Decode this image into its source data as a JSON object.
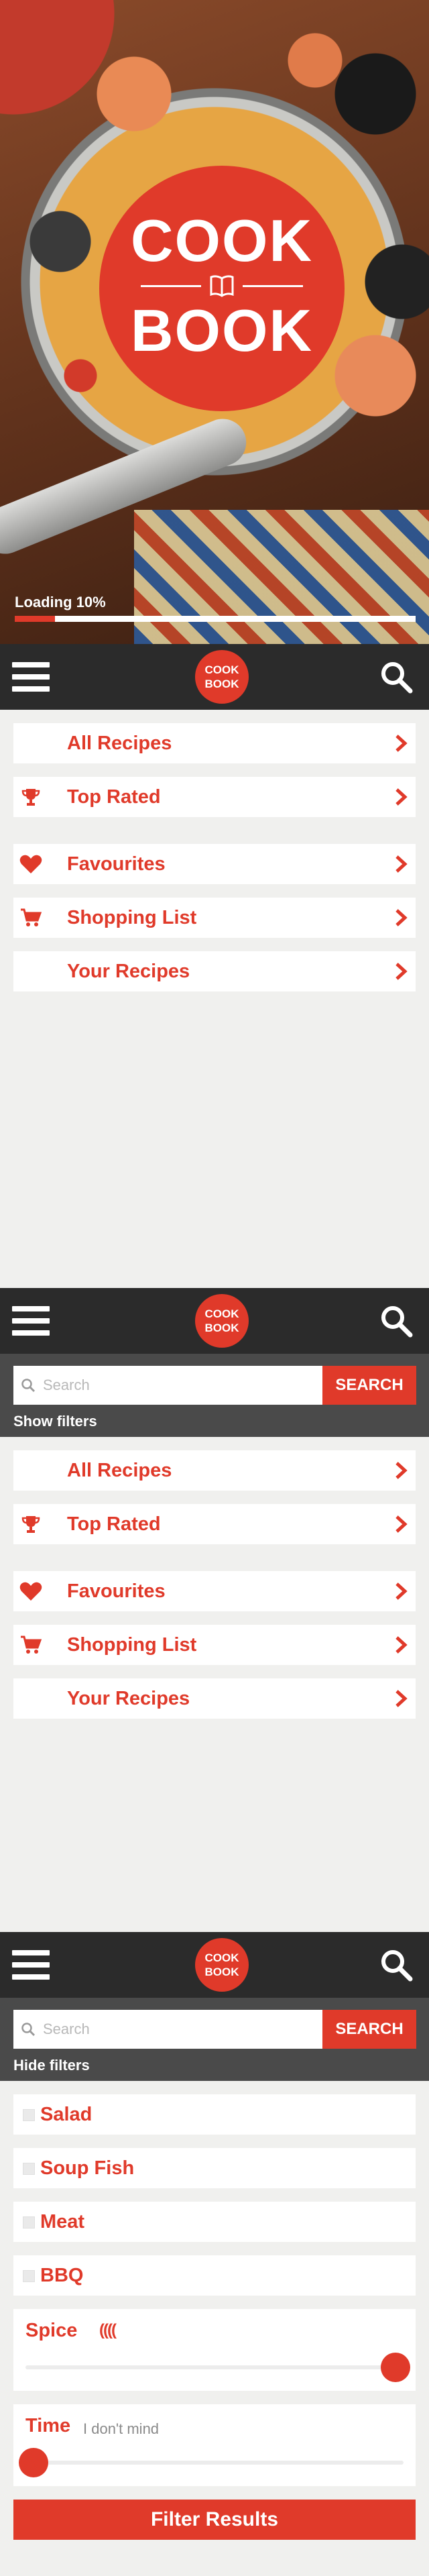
{
  "splash": {
    "logo": {
      "line1": "COOK",
      "line2": "BOOK"
    },
    "loading_label": "Loading 10%",
    "progress": 0.1
  },
  "header": {
    "logo_line1": "COOK",
    "logo_line2": "BOOK"
  },
  "search": {
    "placeholder": "Search",
    "button_label": "SEARCH",
    "show_filters": "Show filters",
    "hide_filters": "Hide filters"
  },
  "menu": {
    "items": [
      {
        "label": "All Recipes",
        "icon": "none"
      },
      {
        "label": "Top Rated",
        "icon": "trophy-icon"
      },
      {
        "label": "Favourites",
        "icon": "heart-icon"
      },
      {
        "label": "Shopping List",
        "icon": "cart-icon"
      },
      {
        "label": "Your Recipes",
        "icon": "none"
      }
    ]
  },
  "filters": {
    "categories": [
      "Salad",
      "Soup Fish",
      "Meat",
      "BBQ"
    ],
    "spice": {
      "label": "Spice",
      "icon_text": "((((",
      "level": 1.0
    },
    "time": {
      "label": "Time",
      "value_text": "I don't mind",
      "level": 0.0
    },
    "submit_label": "Filter Results"
  },
  "colors": {
    "accent": "#e03a2a",
    "header_bg": "#2b2b2b",
    "searchbar_bg": "#4a4a4a",
    "page_bg": "#f0f0ee"
  }
}
